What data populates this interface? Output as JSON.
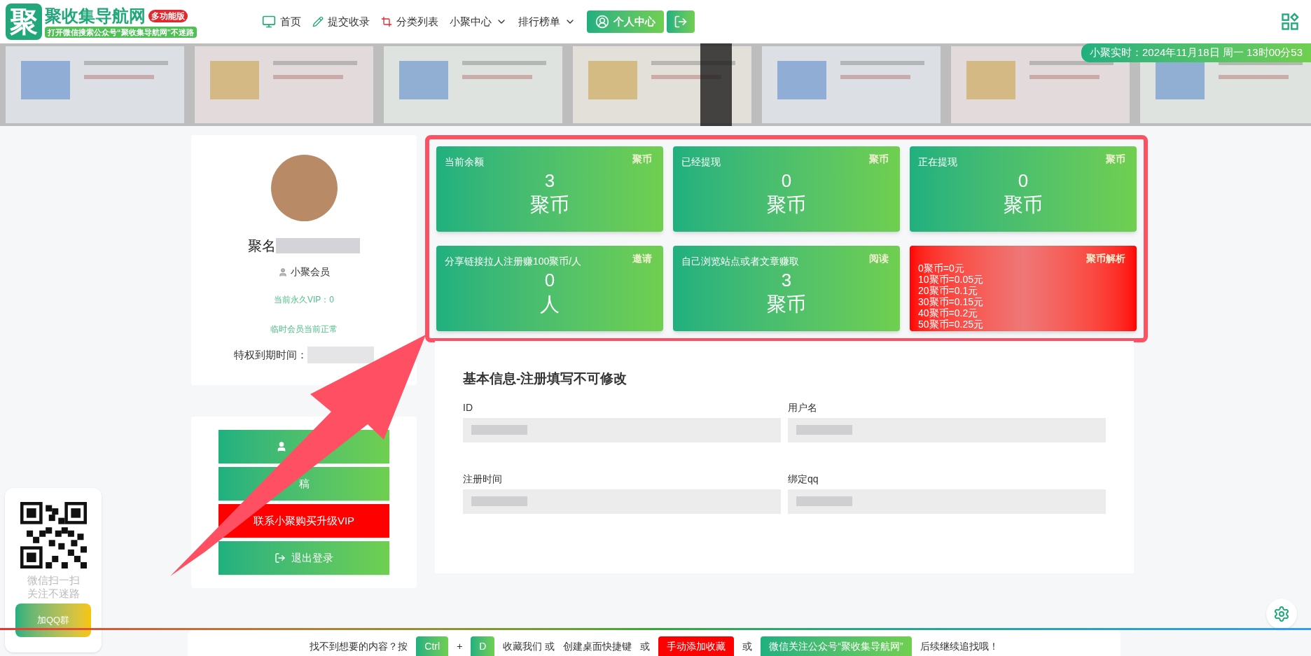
{
  "header": {
    "logo": {
      "mark": "聚",
      "title": "聚收集导航网",
      "badge": "多功能版",
      "slogan": "打开微信搜索公众号“聚收集导航网”不迷路"
    },
    "nav": [
      {
        "label": "首页",
        "dropdown": false
      },
      {
        "label": "提交收录",
        "dropdown": false
      },
      {
        "label": "分类列表",
        "dropdown": false
      },
      {
        "label": "小聚中心",
        "dropdown": true
      },
      {
        "label": "排行榜单",
        "dropdown": true
      }
    ],
    "user_button": "个人中心"
  },
  "clock": "小聚实时：2024年11月18日 周一 13时00分53",
  "profile": {
    "name": "聚名",
    "role": "小聚会员",
    "vip": "当前永久VIP：0",
    "temp_status": "临时会员当前正常",
    "expiry_label": "特权到期时间："
  },
  "stats": [
    {
      "kind": "stat",
      "label": "当前余额",
      "tag": "聚币",
      "value": "3",
      "unit": "聚币"
    },
    {
      "kind": "stat",
      "label": "已经提现",
      "tag": "聚币",
      "value": "0",
      "unit": "聚币"
    },
    {
      "kind": "stat",
      "label": "正在提现",
      "tag": "聚币",
      "value": "0",
      "unit": "聚币"
    },
    {
      "kind": "stat",
      "label": "分享链接拉人注册赚100聚币/人",
      "tag": "邀请",
      "value": "0",
      "unit": "人"
    },
    {
      "kind": "stat",
      "label": "自己浏览站点或者文章赚取",
      "tag": "阅读",
      "value": "3",
      "unit": "聚币"
    },
    {
      "kind": "rates",
      "tag": "聚币解析",
      "lines": [
        "0聚币=0元",
        "10聚币=0.05元",
        "20聚币=0.1元",
        "30聚币=0.15元",
        "40聚币=0.2元",
        "50聚币=0.25元"
      ]
    }
  ],
  "side_buttons": [
    {
      "kind": "green"
    },
    {
      "label": "稿",
      "kind": "green"
    },
    {
      "label": "联系小聚购买升级VIP",
      "kind": "red"
    },
    {
      "label": "退出登录",
      "kind": "green"
    }
  ],
  "info": {
    "title": "基本信息-注册填写不可修改",
    "fields": [
      {
        "label": "ID"
      },
      {
        "label": "用户名"
      },
      {
        "label": "注册时间"
      },
      {
        "label": "绑定qq"
      }
    ]
  },
  "qr_widget": {
    "lines": [
      "微信扫一扫",
      "关注不迷路"
    ],
    "button": "加QQ群"
  },
  "footer": {
    "parts": [
      {
        "kind": "text",
        "text": "找不到想要的内容？按"
      },
      {
        "kind": "key",
        "text": "Ctrl"
      },
      {
        "kind": "text",
        "text": "+"
      },
      {
        "kind": "key",
        "text": "D"
      },
      {
        "kind": "text",
        "text": "收藏我们 或"
      },
      {
        "kind": "text",
        "text": "创建桌面快捷键"
      },
      {
        "kind": "text",
        "text": "或"
      },
      {
        "kind": "red",
        "text": "手动添加收藏"
      },
      {
        "kind": "text",
        "text": "或"
      },
      {
        "kind": "key",
        "text": "微信关注公众号“聚收集导航网”"
      },
      {
        "kind": "text",
        "text": "后续继续追找哦！"
      }
    ]
  }
}
